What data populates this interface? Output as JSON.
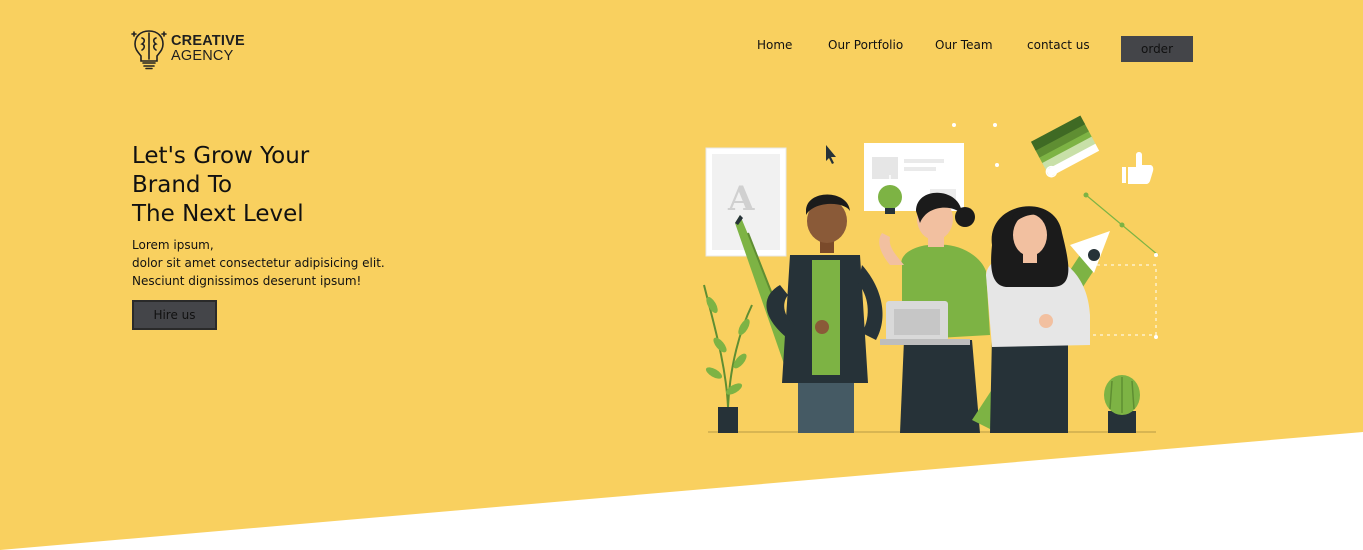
{
  "brand": {
    "name_line1": "CREATIVE",
    "name_line2": "AGENCY",
    "logo_icon": "brain-lightbulb-icon"
  },
  "nav": {
    "items": [
      {
        "label": "Home"
      },
      {
        "label": "Our Portfolio"
      },
      {
        "label": "Our Team"
      },
      {
        "label": "contact us"
      }
    ],
    "order_label": "order"
  },
  "hero": {
    "title_lines": [
      "Let's Grow Your",
      "Brand To",
      "The Next Level"
    ],
    "text_lines": [
      "Lorem ipsum,",
      "dolor sit amet consectetur adipisicing elit.",
      "Nesciunt dignissimos deserunt ipsum!"
    ],
    "cta_label": "Hire us",
    "illustration": "creative-team-illustration"
  },
  "colors": {
    "background_yellow": "#F9D05F",
    "button_dark": "#444549",
    "accent_green": "#7DB344",
    "dark": "#263238"
  }
}
